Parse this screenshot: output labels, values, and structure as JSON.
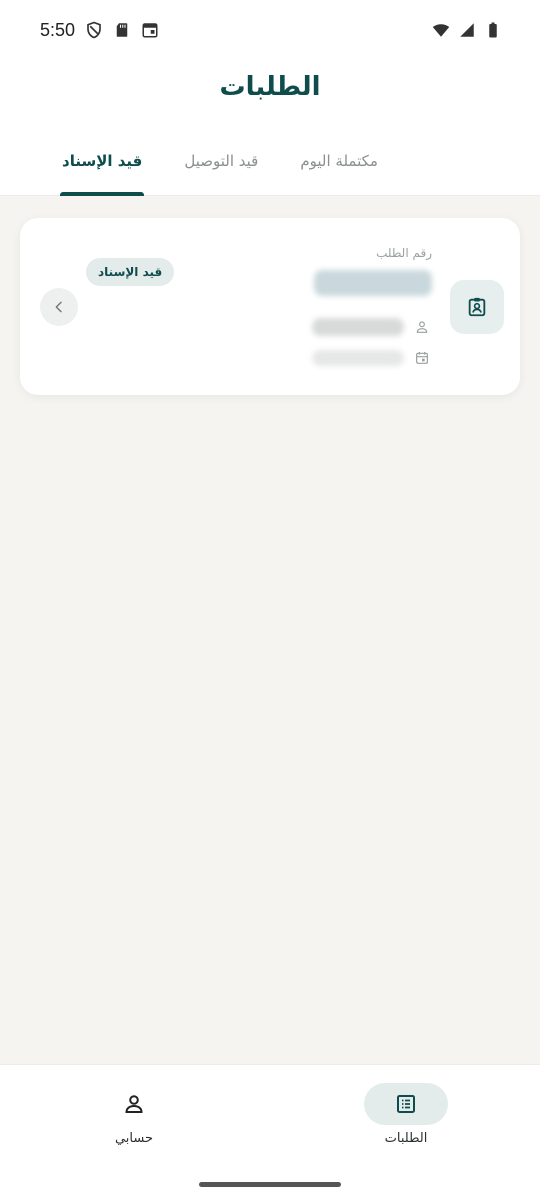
{
  "status_bar": {
    "time": "5:50",
    "icons": [
      "shield-icon",
      "sd-card-icon",
      "calendar-icon",
      "wifi-icon",
      "signal-icon",
      "battery-icon"
    ]
  },
  "header": {
    "title": "الطلبات"
  },
  "tabs": [
    {
      "label": "قيد الإسناد",
      "active": true
    },
    {
      "label": "قيد التوصيل",
      "active": false
    },
    {
      "label": "مكتملة اليوم",
      "active": false
    }
  ],
  "orders": [
    {
      "order_number_label": "رقم الطلب",
      "status": "قيد الإسناد",
      "icon": "assignment-ind-icon"
    }
  ],
  "bottom_nav": {
    "items": [
      {
        "label": "الطلبات",
        "icon": "receipt-list-icon",
        "active": true
      },
      {
        "label": "حسابي",
        "icon": "person-icon",
        "active": false
      }
    ]
  },
  "colors": {
    "primary": "#0f4d4d",
    "background": "#f5f4f0",
    "pill": "#e4ebeb"
  }
}
